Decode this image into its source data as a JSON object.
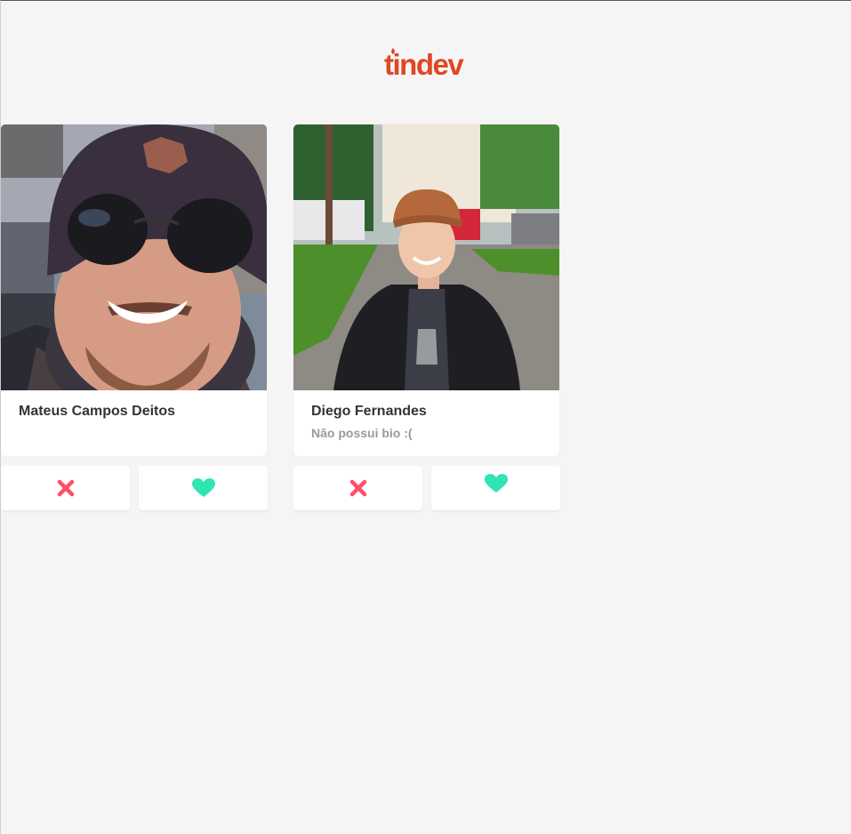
{
  "brand": {
    "name": "tindev",
    "color": "#df4723"
  },
  "devs": [
    {
      "name": "Mateus Campos Deitos",
      "bio": "",
      "avatar": "person-in-beanie-and-sunglasses-photo"
    },
    {
      "name": "Diego Fernandes",
      "bio": "Não possui bio :(",
      "avatar": "person-in-orange-cap-and-leather-jacket-photo"
    }
  ],
  "actions": {
    "dislike_icon": "close-x-icon",
    "like_icon": "heart-icon",
    "dislike_color": "#ff4f6a",
    "like_color": "#2fe5b3"
  }
}
